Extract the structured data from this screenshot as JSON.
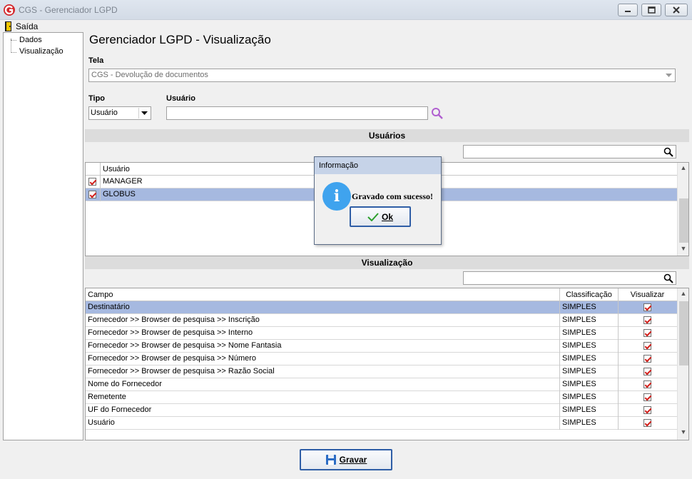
{
  "window": {
    "title": "CGS - Gerenciador LGPD"
  },
  "menu": {
    "saida": "Saída"
  },
  "tree": {
    "items": [
      "Dados",
      "Visualização"
    ]
  },
  "page": {
    "title": "Gerenciador LGPD - Visualização"
  },
  "tela": {
    "label": "Tela",
    "value": "CGS - Devolução de documentos"
  },
  "tipo": {
    "label": "Tipo",
    "value": "Usuário"
  },
  "usuario": {
    "label": "Usuário",
    "value": ""
  },
  "usuarios_section": {
    "title": "Usuários",
    "search_value": "",
    "column": "Usuário",
    "rows": [
      {
        "name": "MANAGER",
        "checked": true,
        "selected": false
      },
      {
        "name": "GLOBUS",
        "checked": true,
        "selected": true
      }
    ]
  },
  "visualizacao_section": {
    "title": "Visualização",
    "search_value": "",
    "columns": [
      "Campo",
      "Classificação",
      "Visualizar"
    ],
    "rows": [
      {
        "campo": "Destinatário",
        "classificacao": "SIMPLES",
        "visualizar": true,
        "selected": true
      },
      {
        "campo": "Fornecedor >> Browser de pesquisa >> Inscrição",
        "classificacao": "SIMPLES",
        "visualizar": true
      },
      {
        "campo": "Fornecedor >> Browser de pesquisa >> Interno",
        "classificacao": "SIMPLES",
        "visualizar": true
      },
      {
        "campo": "Fornecedor >> Browser de pesquisa >> Nome Fantasia",
        "classificacao": "SIMPLES",
        "visualizar": true
      },
      {
        "campo": "Fornecedor >> Browser de pesquisa >> Número",
        "classificacao": "SIMPLES",
        "visualizar": true
      },
      {
        "campo": "Fornecedor >> Browser de pesquisa >> Razão Social",
        "classificacao": "SIMPLES",
        "visualizar": true
      },
      {
        "campo": "Nome do Fornecedor",
        "classificacao": "SIMPLES",
        "visualizar": true
      },
      {
        "campo": "Remetente",
        "classificacao": "SIMPLES",
        "visualizar": true
      },
      {
        "campo": "UF do Fornecedor",
        "classificacao": "SIMPLES",
        "visualizar": true
      },
      {
        "campo": "Usuário",
        "classificacao": "SIMPLES",
        "visualizar": true
      }
    ]
  },
  "dialog": {
    "title": "Informação",
    "message": "Gravado com sucesso!",
    "icon": "info-icon",
    "ok_label": "Ok"
  },
  "footer": {
    "gravar_label": "Gravar"
  },
  "colors": {
    "selection": "#a6b9e0",
    "checkmark": "#d0201c",
    "dialog_title": "#c6d3e8",
    "info_icon": "#3fa3ee"
  }
}
